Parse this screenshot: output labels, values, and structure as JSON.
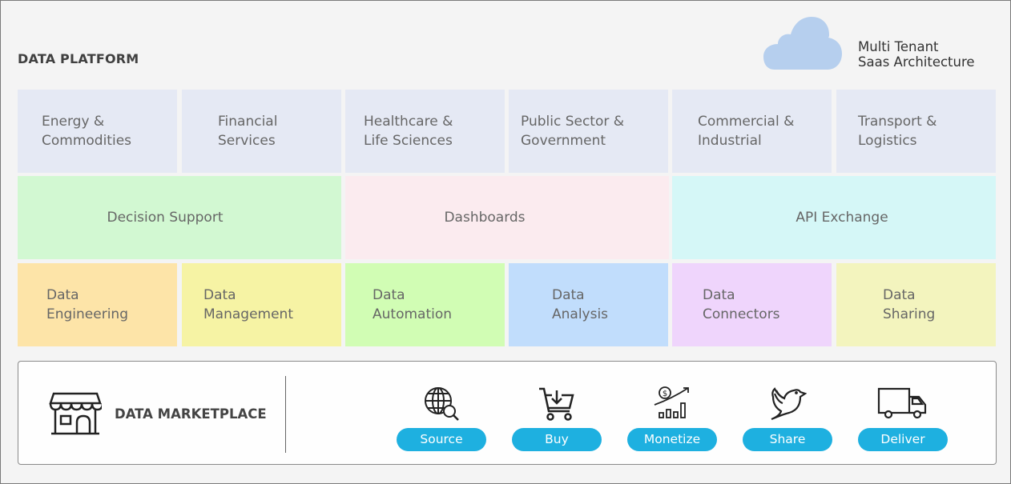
{
  "header": {
    "title": "DATA PLATFORM",
    "architecture": [
      "Multi Tenant",
      "Saas Architecture"
    ],
    "cloud_color": "#b6cfee"
  },
  "industries": [
    {
      "line1": "Energy &",
      "line2": "Commodities"
    },
    {
      "line1": "Financial",
      "line2": "Services"
    },
    {
      "line1": "Healthcare &",
      "line2": "Life Sciences"
    },
    {
      "line1": "Public Sector &",
      "line2": "Government"
    },
    {
      "line1": "Commercial &",
      "line2": "Industrial"
    },
    {
      "line1": "Transport &",
      "line2": "Logistics"
    }
  ],
  "solutions": [
    {
      "label": "Decision Support",
      "color": "#d2f8d2"
    },
    {
      "label": "Dashboards",
      "color": "#fbebef"
    },
    {
      "label": "API Exchange",
      "color": "#d5f7f7"
    }
  ],
  "capabilities": [
    {
      "line1": "Data",
      "line2": "Engineering",
      "color": "#fde4a8"
    },
    {
      "line1": "Data",
      "line2": "Management",
      "color": "#f6f3a4"
    },
    {
      "line1": "Data",
      "line2": "Automation",
      "color": "#d1fdb4"
    },
    {
      "line1": "Data",
      "line2": "Analysis",
      "color": "#c1ddfc"
    },
    {
      "line1": "Data",
      "line2": "Connectors",
      "color": "#efd5fc"
    },
    {
      "line1": "Data",
      "line2": "Sharing",
      "color": "#f3f4be"
    }
  ],
  "marketplace": {
    "label": "DATA MARKETPLACE",
    "icon": "storefront-icon",
    "accent": "#1eb0e0",
    "actions": [
      {
        "label": "Source",
        "icon": "globe-search-icon"
      },
      {
        "label": "Buy",
        "icon": "cart-download-icon"
      },
      {
        "label": "Monetize",
        "icon": "money-growth-icon"
      },
      {
        "label": "Share",
        "icon": "bird-icon"
      },
      {
        "label": "Deliver",
        "icon": "truck-icon"
      }
    ]
  }
}
